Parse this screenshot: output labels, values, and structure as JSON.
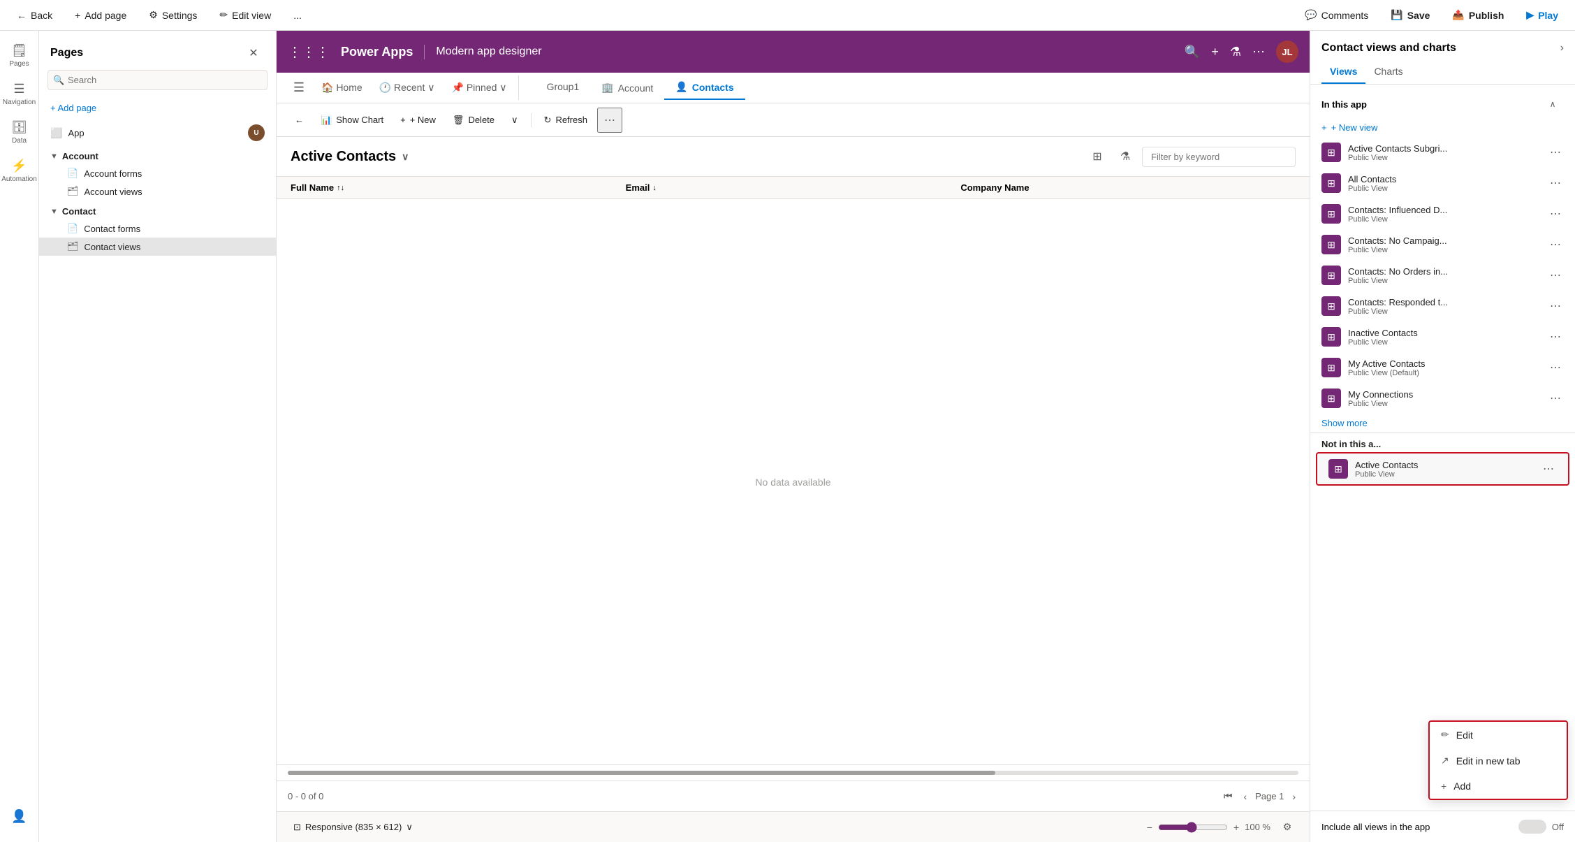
{
  "topbar": {
    "back_label": "Back",
    "add_page_label": "Add page",
    "settings_label": "Settings",
    "edit_view_label": "Edit view",
    "more_label": "...",
    "comments_label": "Comments",
    "save_label": "Save",
    "publish_label": "Publish",
    "play_label": "Play"
  },
  "pages_panel": {
    "title": "Pages",
    "search_placeholder": "Search",
    "add_page_label": "+ Add page",
    "items": [
      {
        "label": "App",
        "icon": "🟦",
        "has_badge": true
      },
      {
        "label": "Account",
        "icon": "▼",
        "is_group": true
      },
      {
        "label": "Account forms",
        "icon": "📄",
        "indent": true
      },
      {
        "label": "Account views",
        "icon": "🗂",
        "indent": true
      },
      {
        "label": "Contact",
        "icon": "▼",
        "is_group": true
      },
      {
        "label": "Contact forms",
        "icon": "📄",
        "indent": true
      },
      {
        "label": "Contact views",
        "icon": "🗂",
        "indent": true,
        "active": true
      }
    ]
  },
  "nav_outer": {
    "items": [
      {
        "label": "Pages",
        "icon": "🗒"
      },
      {
        "label": "Navigation",
        "icon": "☰"
      },
      {
        "label": "Data",
        "icon": "🗄"
      },
      {
        "label": "Automation",
        "icon": "⚡"
      }
    ]
  },
  "powerapps_bar": {
    "title": "Power Apps",
    "subtitle": "Modern app designer",
    "avatar_text": "JL"
  },
  "command_bar": {
    "back_label": "←",
    "show_chart_label": "Show Chart",
    "new_label": "+ New",
    "delete_label": "🗑 Delete",
    "refresh_label": "↻ Refresh",
    "more_label": "···"
  },
  "data_view": {
    "title": "Active Contacts",
    "filter_placeholder": "Filter by keyword",
    "columns": [
      {
        "name": "Full Name",
        "sortable": true
      },
      {
        "name": "Email",
        "sortable": true
      },
      {
        "name": "Company Name",
        "sortable": false
      }
    ],
    "no_data": "No data available",
    "page_info": "0 - 0 of 0",
    "page_label": "Page 1"
  },
  "bottom_bar": {
    "responsive_label": "Responsive (835 × 612)",
    "zoom_minus": "−",
    "zoom_plus": "+",
    "zoom_pct": "100 %"
  },
  "right_panel": {
    "title": "Contact views and charts",
    "tabs": [
      "Views",
      "Charts"
    ],
    "active_tab": "Views",
    "in_this_app_label": "In this app",
    "new_view_label": "+ New view",
    "views_in_app": [
      {
        "name": "Active Contacts Subgri...",
        "type": "Public View"
      },
      {
        "name": "All Contacts",
        "type": "Public View"
      },
      {
        "name": "Contacts: Influenced D...",
        "type": "Public View"
      },
      {
        "name": "Contacts: No Campaig...",
        "type": "Public View"
      },
      {
        "name": "Contacts: No Orders in...",
        "type": "Public View"
      },
      {
        "name": "Contacts: Responded t...",
        "type": "Public View"
      },
      {
        "name": "Inactive Contacts",
        "type": "Public View"
      },
      {
        "name": "My Active Contacts",
        "type": "Public View (Default)"
      },
      {
        "name": "My Connections",
        "type": "Public View"
      }
    ],
    "show_more_label": "Show more",
    "not_in_app_label": "Not in this a...",
    "not_in_app_views": [
      {
        "name": "Active Contacts",
        "type": "Public View"
      }
    ],
    "context_menu": {
      "items": [
        {
          "label": "Edit",
          "icon": "✏"
        },
        {
          "label": "Edit in new tab",
          "icon": "↗"
        },
        {
          "label": "Add",
          "icon": "+"
        }
      ]
    },
    "include_views_label": "Include all views in the app",
    "toggle_off_label": "Off"
  }
}
